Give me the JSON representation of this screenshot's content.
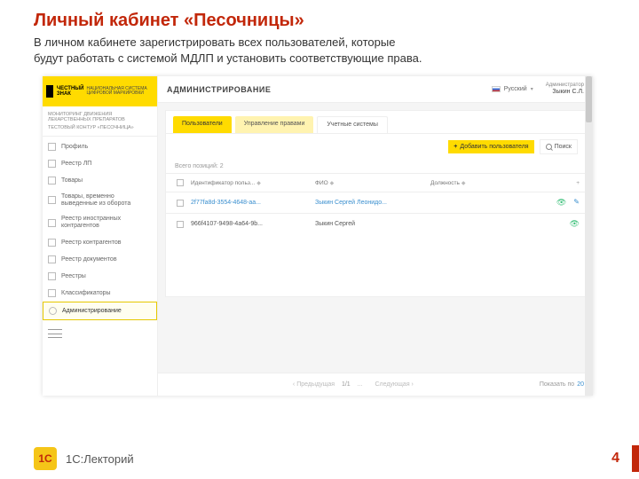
{
  "slide": {
    "title": "Личный кабинет «Песочницы»",
    "desc_l1": "В личном кабинете зарегистрировать всех пользователей, которые",
    "desc_l2": "будут работать с системой МДЛП и установить соответствующие права."
  },
  "sidebar": {
    "logo1": "ЧЕСТНЫЙ",
    "logo2": "ЗНАК",
    "logo_sub": "НАЦИОНАЛЬНАЯ СИСТЕМА ЦИФРОВОЙ МАРКИРОВКИ",
    "meta1": "МОНИТОРИНГ ДВИЖЕНИЯ ЛЕКАРСТВЕННЫХ ПРЕПАРАТОВ",
    "meta2": "ТЕСТОВЫЙ КОНТУР «ПЕСОЧНИЦА»",
    "items": [
      "Профиль",
      "Реестр ЛП",
      "Товары",
      "Товары, временно выведенные из оборота",
      "Реестр иностранных контрагентов",
      "Реестр контрагентов",
      "Реестр документов",
      "Реестры",
      "Классификаторы",
      "Администрирование"
    ]
  },
  "header": {
    "title": "АДМИНИСТРИРОВАНИЕ",
    "language": "Русский",
    "role": "Администратор",
    "user": "Зыкин С.Л."
  },
  "tabs": [
    "Пользователи",
    "Управление правами",
    "Учетные системы"
  ],
  "actions": {
    "add": "Добавить пользователя",
    "search": "Поиск"
  },
  "table": {
    "count_label": "Всего позиций: 2",
    "cols": {
      "id": "Идентификатор польз...",
      "fio": "ФИО",
      "role": "Должность"
    },
    "rows": [
      {
        "id": "2f77fa8d-3554-4648-aa...",
        "fio": "Зыкин Сергей Леонидо...",
        "link": true,
        "edit": true
      },
      {
        "id": "966f4107-9498-4a64-9b...",
        "fio": "Зыкин Сергей",
        "link": false,
        "edit": false
      }
    ]
  },
  "pager": {
    "prev": "Предыдущая",
    "next": "Следующая",
    "pos": "1/1",
    "dots": "...",
    "show_by": "Показать по",
    "per_page": "20"
  },
  "footer": {
    "brand": "1С:Лекторий",
    "logo": "1C",
    "page": "4"
  }
}
